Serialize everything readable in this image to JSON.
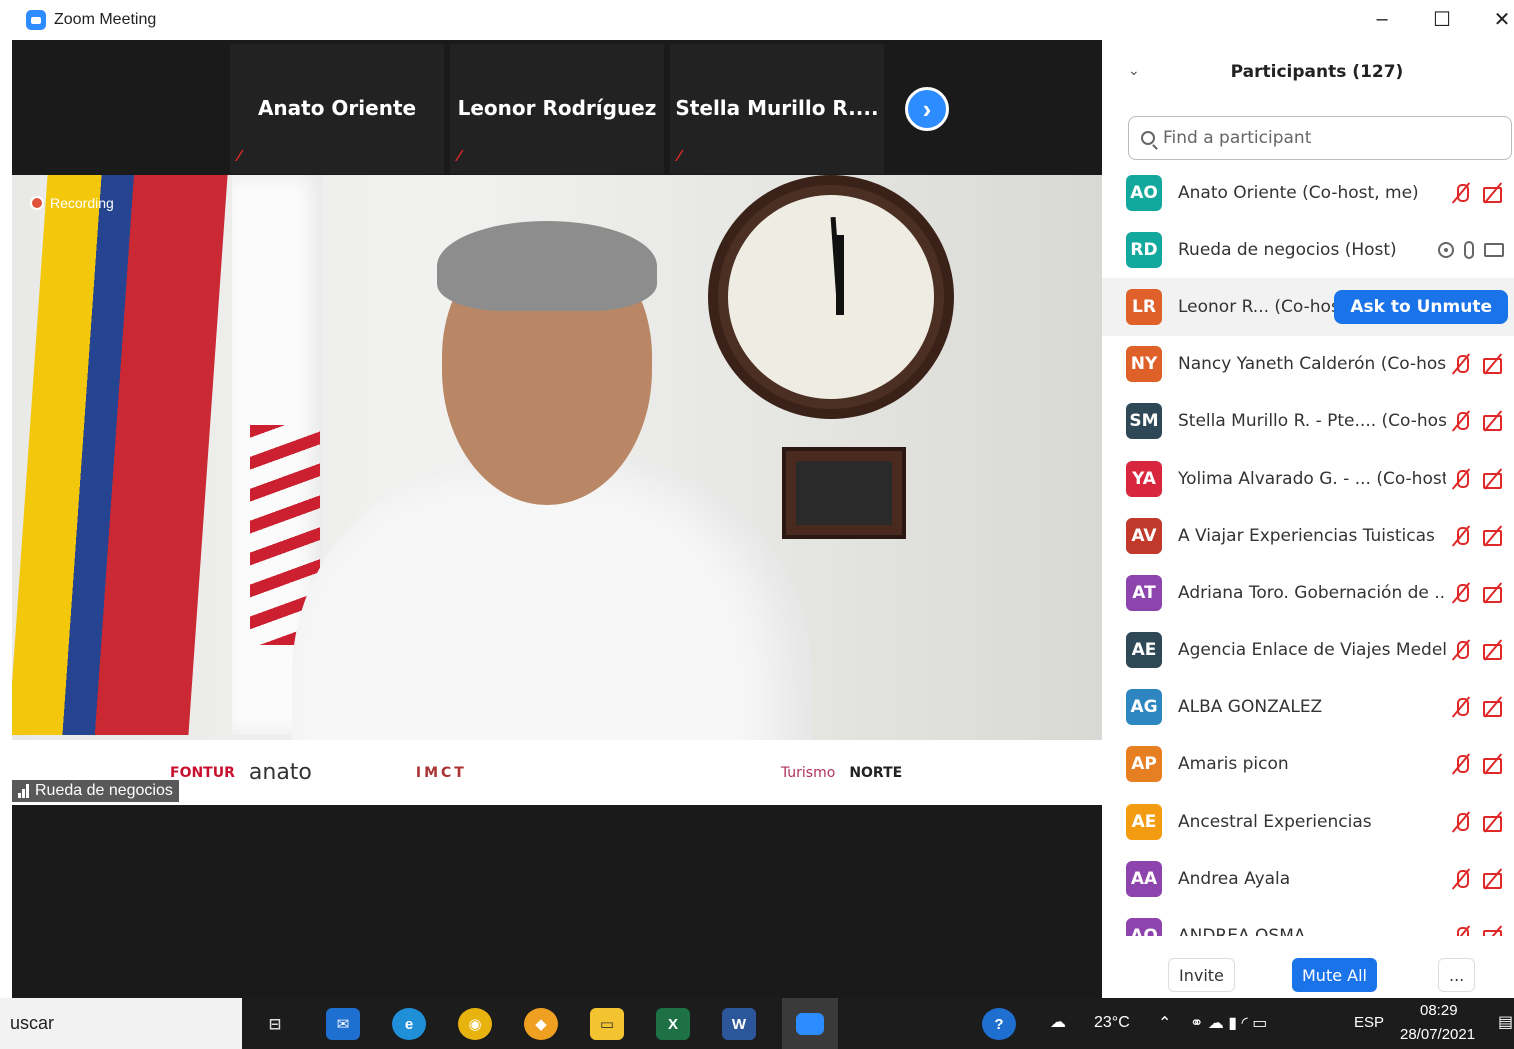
{
  "window": {
    "title": "Zoom Meeting"
  },
  "thumbnails": [
    {
      "name": "Anato Oriente"
    },
    {
      "name": "Leonor Rodríguez"
    },
    {
      "name": "Stella  Murillo  R...."
    }
  ],
  "video": {
    "recording_label": "Recording",
    "speaker_tag": "Rueda de negocios",
    "logos": [
      "FONTUR",
      "anato",
      "IMCT",
      "NORTE",
      "Turismo"
    ]
  },
  "panel": {
    "title": "Participants (127)",
    "search_placeholder": "Find a participant",
    "participants": [
      {
        "initials": "AO",
        "name": "Anato Oriente (Co-host, me)",
        "color": "#13a89e",
        "status": "muted"
      },
      {
        "initials": "RD",
        "name": "Rueda de negocios (Host)",
        "color": "#13a89e",
        "status": "active"
      },
      {
        "initials": "LR",
        "name": "Leonor R... (Co-host)",
        "color": "#e0602a",
        "status": "hover",
        "action": "Ask to Unmute"
      },
      {
        "initials": "NY",
        "name": "Nancy Yaneth Calderón (Co-host)",
        "color": "#e0602a",
        "status": "muted"
      },
      {
        "initials": "SM",
        "name": "Stella Murillo R. - Pte.... (Co-host)",
        "color": "#2f4858",
        "status": "muted"
      },
      {
        "initials": "YA",
        "name": "Yolima Alvarado G. - ... (Co-host)",
        "color": "#d7263d",
        "status": "muted"
      },
      {
        "initials": "AV",
        "name": "A Viajar Experiencias Tuisticas",
        "color": "#c0392b",
        "status": "muted"
      },
      {
        "initials": "AT",
        "name": "Adriana Toro. Gobernación de ...",
        "color": "#8e44ad",
        "status": "muted"
      },
      {
        "initials": "AE",
        "name": "Agencia Enlace de Viajes Medel...",
        "color": "#2f4858",
        "status": "muted"
      },
      {
        "initials": "AG",
        "name": "ALBA GONZALEZ",
        "color": "#2e86c1",
        "status": "muted"
      },
      {
        "initials": "AP",
        "name": "Amaris picon",
        "color": "#e67e22",
        "status": "muted"
      },
      {
        "initials": "AE",
        "name": "Ancestral Experiencias",
        "color": "#f39c12",
        "status": "muted"
      },
      {
        "initials": "AA",
        "name": "Andrea Ayala",
        "color": "#8e44ad",
        "status": "muted"
      },
      {
        "initials": "AO",
        "name": "ANDREA OSMA",
        "color": "#8e44ad",
        "status": "muted"
      }
    ],
    "footer": {
      "invite": "Invite",
      "mute_all": "Mute All",
      "more": "..."
    }
  },
  "taskbar": {
    "search_text": "uscar",
    "weather": "23°C",
    "language": "ESP",
    "time": "08:29",
    "date": "28/07/2021"
  }
}
